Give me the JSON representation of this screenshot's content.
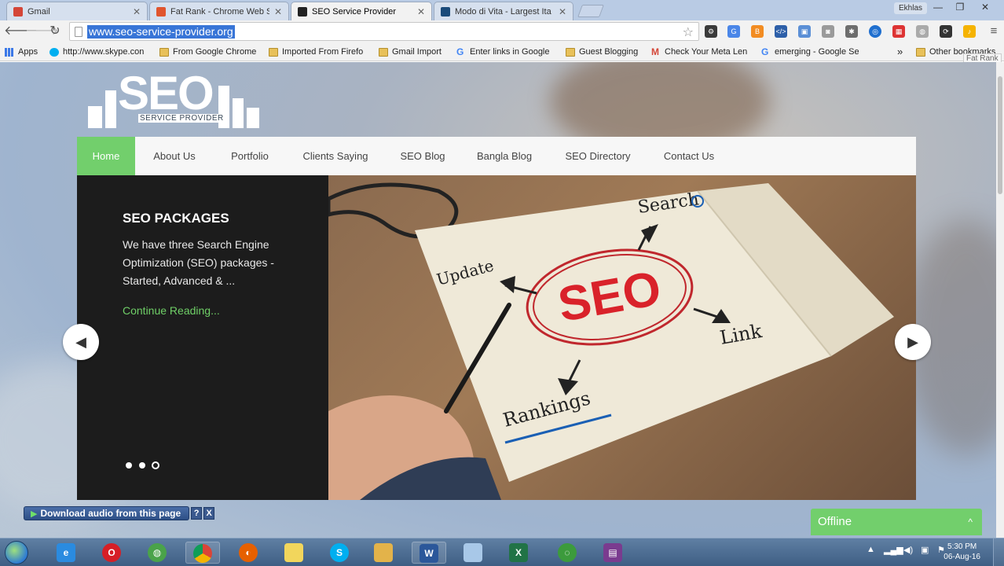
{
  "browser": {
    "tabs": [
      {
        "title": "Gmail",
        "favicon_color": "#d44638"
      },
      {
        "title": "Fat Rank - Chrome Web S",
        "favicon_color": "#e0552e"
      },
      {
        "title": "SEO Service Provider",
        "favicon_color": "#222222"
      },
      {
        "title": "Modo di Vita - Largest Ita",
        "favicon_color": "#1a4b7a"
      }
    ],
    "window_user": "Ekhlas",
    "window_controls": {
      "minimize": "—",
      "restore": "❐",
      "close": "✕"
    },
    "address_url": "www.seo-service-provider.org",
    "bookmarks": [
      {
        "label": "Apps",
        "kind": "apps"
      },
      {
        "label": "http://www.skype.con",
        "kind": "skype"
      },
      {
        "label": "From Google Chrome",
        "kind": "folder"
      },
      {
        "label": "Imported From Firefo",
        "kind": "folder"
      },
      {
        "label": "Gmail Import",
        "kind": "folder"
      },
      {
        "label": "Enter links in Google",
        "kind": "google"
      },
      {
        "label": "Guest Blogging",
        "kind": "folder"
      },
      {
        "label": "Check Your Meta Len",
        "kind": "gmail"
      },
      {
        "label": "emerging - Google Se",
        "kind": "google"
      },
      {
        "label": "Other bookmarks",
        "kind": "folder"
      }
    ],
    "bookmarks_overflow": "»",
    "tooltip": "Fat Rank"
  },
  "site": {
    "logo": {
      "word": "SEO",
      "subtitle": "SERVICE PROVIDER"
    },
    "nav": [
      {
        "label": "Home",
        "active": true
      },
      {
        "label": "About Us",
        "active": false
      },
      {
        "label": "Portfolio",
        "active": false
      },
      {
        "label": "Clients Saying",
        "active": false
      },
      {
        "label": "SEO Blog",
        "active": false
      },
      {
        "label": "Bangla Blog",
        "active": false
      },
      {
        "label": "SEO Directory",
        "active": false
      },
      {
        "label": "Contact Us",
        "active": false
      }
    ],
    "slider": {
      "title": "SEO PACKAGES",
      "text": "We have three Search Engine Optimization (SEO) packages - Started, Advanced & ...",
      "link": "Continue Reading...",
      "image_words": {
        "center": "SEO",
        "search": "Search",
        "update": "Update",
        "link": "Link",
        "rankings": "Rankings"
      },
      "dots_total": 3,
      "active_dot": 3
    },
    "download_bar": {
      "label": "Download audio from this page",
      "help": "?",
      "close": "X"
    },
    "chat": {
      "label": "Offline",
      "chevron": "^"
    }
  },
  "taskbar": {
    "clock_time": "5:30 PM",
    "clock_date": "06-Aug-16"
  },
  "colors": {
    "accent_green": "#72cf6c",
    "selection_blue": "#3875d7",
    "slider_dark": "#1c1c1c"
  }
}
